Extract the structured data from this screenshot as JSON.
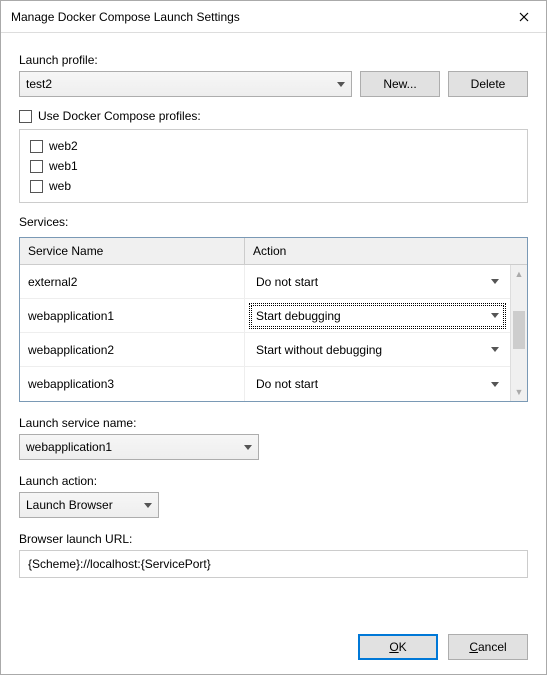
{
  "title": "Manage Docker Compose Launch Settings",
  "labels": {
    "launch_profile": "Launch profile:",
    "use_profiles": "Use Docker Compose profiles:",
    "services": "Services:",
    "col_service": "Service Name",
    "col_action": "Action",
    "launch_service": "Launch service name:",
    "launch_action": "Launch action:",
    "browser_url": "Browser launch URL:"
  },
  "buttons": {
    "new": "New...",
    "delete": "Delete",
    "ok": "K",
    "ok_prefix": "O",
    "cancel_prefix": "C",
    "cancel": "ancel"
  },
  "profile_select": "test2",
  "use_profiles_checked": false,
  "profiles": [
    {
      "label": "web2"
    },
    {
      "label": "web1"
    },
    {
      "label": "web"
    }
  ],
  "services_rows": [
    {
      "name": "external2",
      "action": "Do not start",
      "focused": false
    },
    {
      "name": "webapplication1",
      "action": "Start debugging",
      "focused": true
    },
    {
      "name": "webapplication2",
      "action": "Start without debugging",
      "focused": false
    },
    {
      "name": "webapplication3",
      "action": "Do not start",
      "focused": false
    }
  ],
  "launch_service": "webapplication1",
  "launch_action": "Launch Browser",
  "browser_url": "{Scheme}://localhost:{ServicePort}"
}
